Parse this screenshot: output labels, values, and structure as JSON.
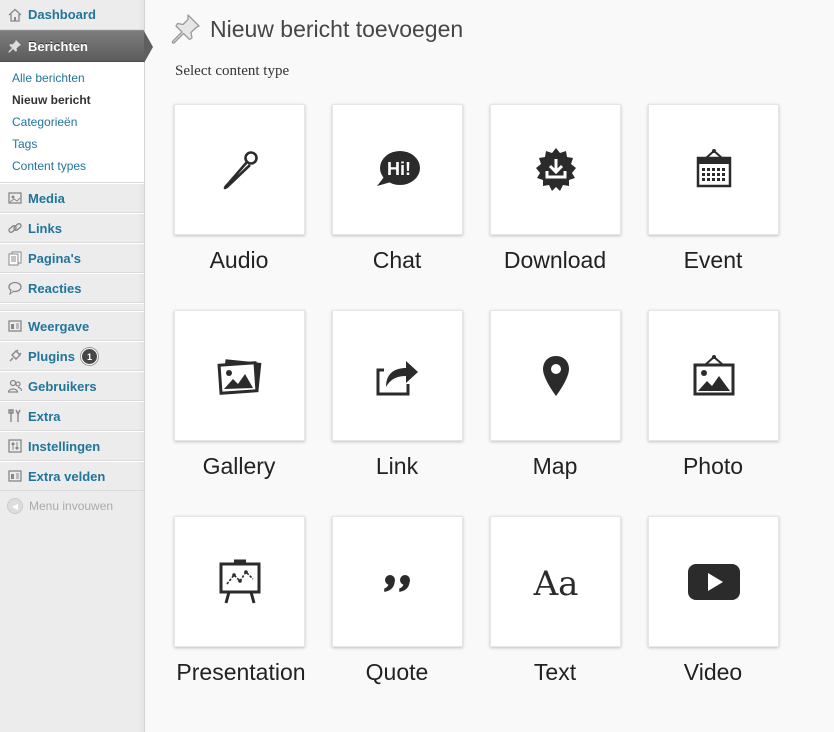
{
  "sidebar": {
    "items": [
      {
        "label": "Dashboard",
        "icon": "dashboard-icon"
      },
      {
        "label": "Berichten",
        "icon": "pin-icon"
      },
      {
        "label": "Media",
        "icon": "media-icon"
      },
      {
        "label": "Links",
        "icon": "links-icon"
      },
      {
        "label": "Pagina's",
        "icon": "pages-icon"
      },
      {
        "label": "Reacties",
        "icon": "comments-icon"
      },
      {
        "label": "Weergave",
        "icon": "appearance-icon"
      },
      {
        "label": "Plugins",
        "icon": "plugins-icon",
        "badge": "1"
      },
      {
        "label": "Gebruikers",
        "icon": "users-icon"
      },
      {
        "label": "Extra",
        "icon": "tools-icon"
      },
      {
        "label": "Instellingen",
        "icon": "settings-icon"
      },
      {
        "label": "Extra velden",
        "icon": "fields-icon"
      }
    ],
    "submenu": [
      "Alle berichten",
      "Nieuw bericht",
      "Categorieën",
      "Tags",
      "Content types"
    ],
    "collapse_label": "Menu invouwen"
  },
  "main": {
    "title": "Nieuw bericht toevoegen",
    "subtitle": "Select content type",
    "types": [
      {
        "label": "Audio",
        "icon": "microphone-icon"
      },
      {
        "label": "Chat",
        "icon": "chat-bubble-icon"
      },
      {
        "label": "Download",
        "icon": "download-badge-icon"
      },
      {
        "label": "Event",
        "icon": "calendar-icon"
      },
      {
        "label": "Gallery",
        "icon": "gallery-icon"
      },
      {
        "label": "Link",
        "icon": "share-arrow-icon"
      },
      {
        "label": "Map",
        "icon": "map-pin-icon"
      },
      {
        "label": "Photo",
        "icon": "photo-frame-icon"
      },
      {
        "label": "Presentation",
        "icon": "easel-chart-icon"
      },
      {
        "label": "Quote",
        "icon": "quote-icon"
      },
      {
        "label": "Text",
        "icon": "text-aa-icon",
        "glyph": "Aa"
      },
      {
        "label": "Video",
        "icon": "play-button-icon"
      }
    ]
  },
  "colors": {
    "link": "#21759b",
    "active_menu": "#6d6d6d",
    "icon": "#333333"
  }
}
